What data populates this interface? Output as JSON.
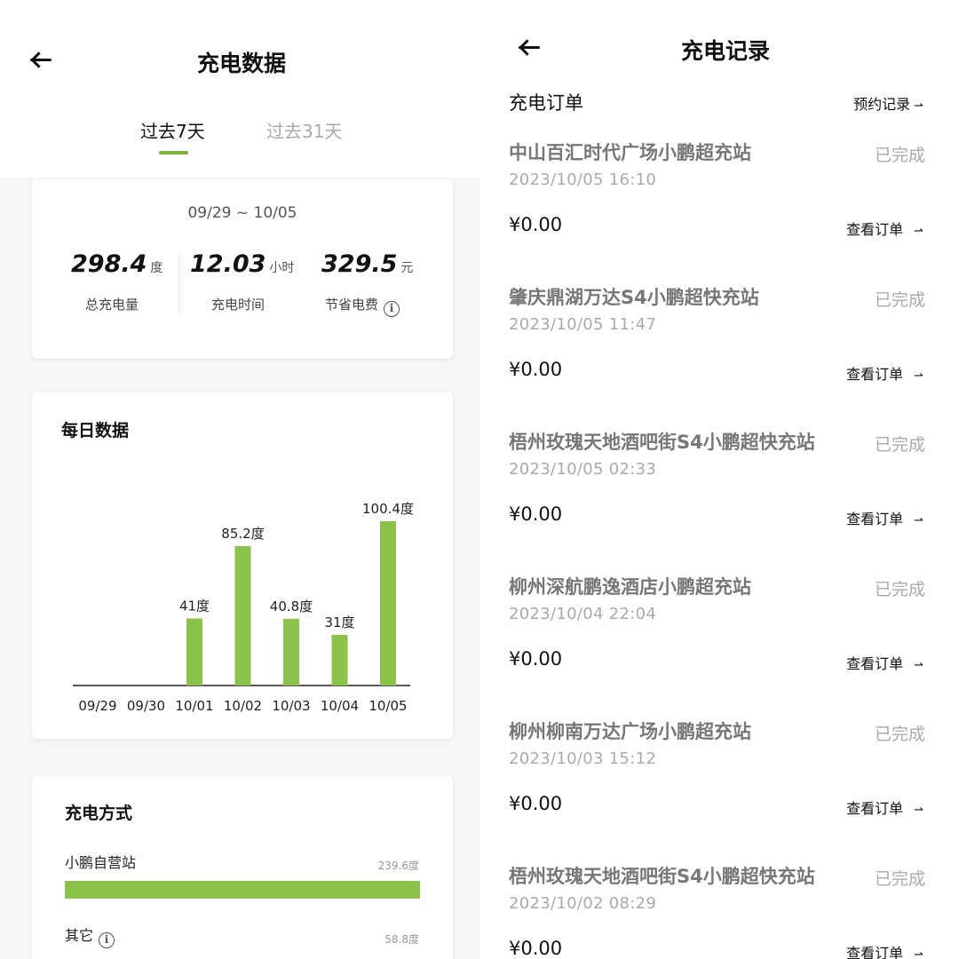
{
  "left": {
    "title": "充电数据",
    "tabs": [
      {
        "label": "过去7天",
        "active": true
      },
      {
        "label": "过去31天",
        "active": false
      }
    ],
    "summary": {
      "date_range": "09/29 ~ 10/05",
      "stats": [
        {
          "value": "298.4",
          "unit": "度",
          "label": "总充电量"
        },
        {
          "value": "12.03",
          "unit": "小时",
          "label": "充电时间"
        },
        {
          "value": "329.5",
          "unit": "元",
          "label": "节省电费"
        }
      ],
      "info_icon": "info-icon"
    },
    "daily": {
      "title": "每日数据"
    },
    "method": {
      "title": "充电方式",
      "items": [
        {
          "label": "小鹏自营站",
          "value": "239.6度",
          "fraction": 0.803
        },
        {
          "label": "其它",
          "value": "58.8度",
          "fraction": 0.197
        }
      ]
    }
  },
  "chart_data": {
    "type": "bar",
    "title": "",
    "categories": [
      "09/29",
      "09/30",
      "10/01",
      "10/02",
      "10/03",
      "10/04",
      "10/05"
    ],
    "values": [
      0,
      0,
      41,
      85.2,
      40.8,
      31,
      100.4
    ],
    "data_labels": [
      "",
      "",
      "41度",
      "85.2度",
      "40.8度",
      "31度",
      "100.4度"
    ],
    "unit": "度",
    "ylim": [
      0,
      100.4
    ],
    "grid": false,
    "color": "#8bc34a"
  },
  "right": {
    "title": "充电记录",
    "orders_heading": "充电订单",
    "reserve_link": "预约记录",
    "view_order_label": "查看订单",
    "orders": [
      {
        "station": "中山百汇时代广场小鹏超充站",
        "time": "2023/10/05  16:10",
        "status": "已完成",
        "price": "¥0.00"
      },
      {
        "station": "肇庆鼎湖万达S4小鹏超快充站",
        "time": "2023/10/05  11:47",
        "status": "已完成",
        "price": "¥0.00"
      },
      {
        "station": "梧州玫瑰天地酒吧街S4小鹏超快充站",
        "time": "2023/10/05  02:33",
        "status": "已完成",
        "price": "¥0.00"
      },
      {
        "station": "柳州深航鹏逸酒店小鹏超充站",
        "time": "2023/10/04  22:04",
        "status": "已完成",
        "price": "¥0.00"
      },
      {
        "station": "柳州柳南万达广场小鹏超充站",
        "time": "2023/10/03  15:12",
        "status": "已完成",
        "price": "¥0.00"
      },
      {
        "station": "梧州玫瑰天地酒吧街S4小鹏超快充站",
        "time": "2023/10/02  08:29",
        "status": "已完成",
        "price": "¥0.00"
      }
    ]
  },
  "colors": {
    "accent": "#8bc34a",
    "tab_underline": "#7bb63a",
    "muted_text": "#aaaaaa",
    "station_text": "#777777"
  },
  "icons": [
    "back-arrow-icon",
    "info-icon",
    "arrow-right-icon"
  ]
}
